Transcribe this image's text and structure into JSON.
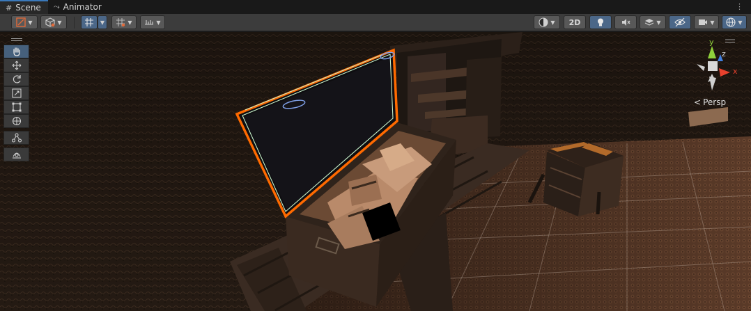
{
  "tabs": [
    {
      "label": "Scene",
      "icon": "grid-icon"
    },
    {
      "label": "Animator",
      "icon": "animator-icon"
    }
  ],
  "toolbar": {
    "mode_2d_label": "2D"
  },
  "gizmo": {
    "axis_y": "y",
    "axis_z": "z",
    "axis_x": "x",
    "projection_label": "Persp"
  },
  "colors": {
    "selection_outline": "#ff6a00",
    "toolbar_active": "#4b6788",
    "gizmo_x": "#e8412d",
    "gizmo_y": "#8fd13b",
    "gizmo_z": "#3f7fe0"
  }
}
